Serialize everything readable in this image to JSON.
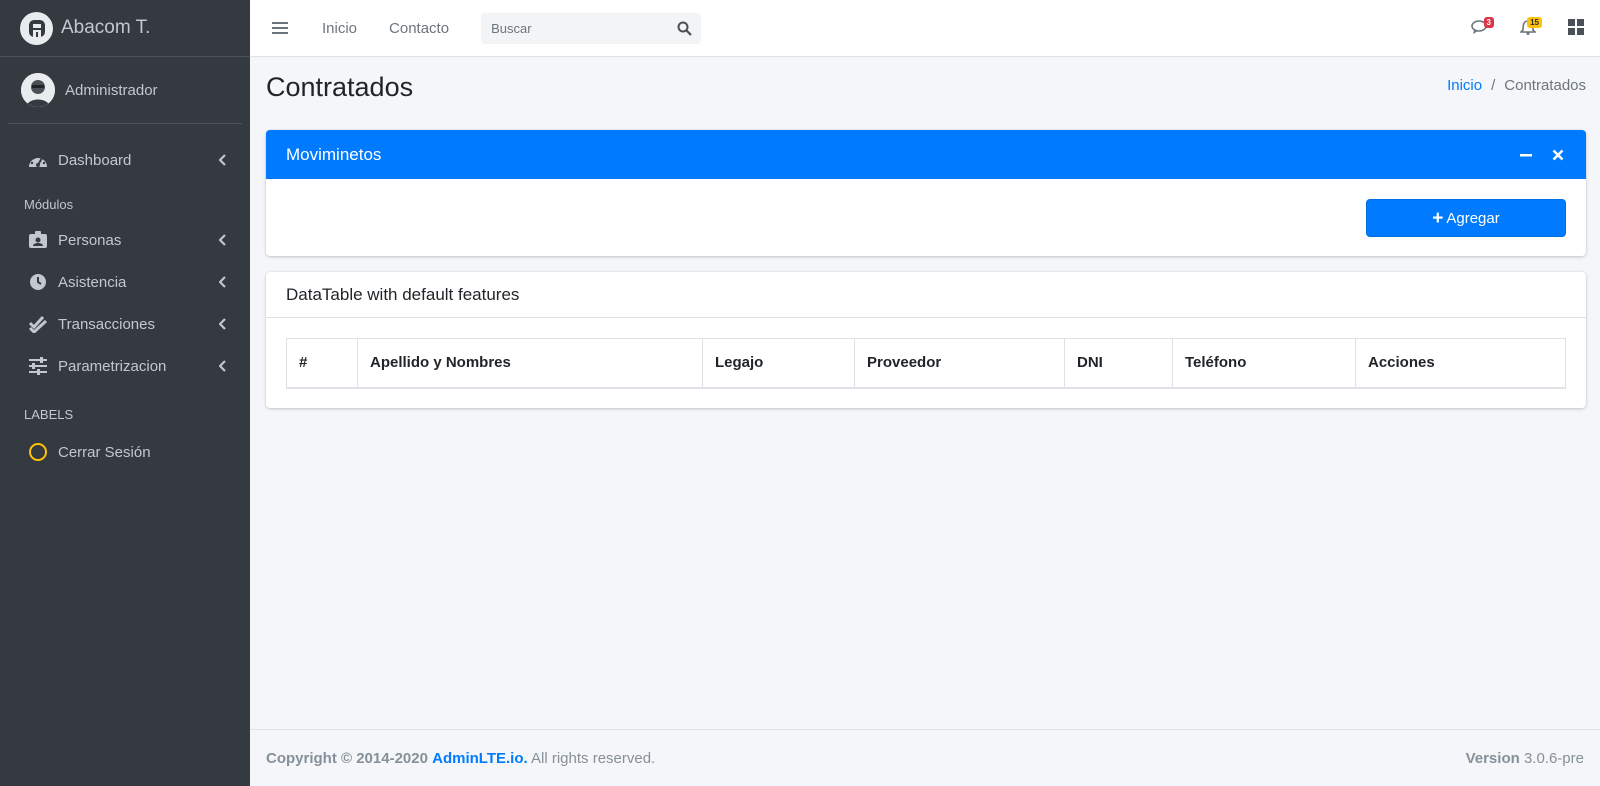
{
  "brand": {
    "name": "Abacom T."
  },
  "user": {
    "name": "Administrador"
  },
  "sidebar": {
    "dashboard": {
      "label": "Dashboard"
    },
    "modules_header": "Módulos",
    "items": [
      {
        "label": "Personas"
      },
      {
        "label": "Asistencia"
      },
      {
        "label": "Transacciones"
      },
      {
        "label": "Parametrizacion"
      }
    ],
    "labels_header": "LABELS",
    "logout": {
      "label": "Cerrar Sesión"
    }
  },
  "navbar": {
    "links": [
      "Inicio",
      "Contacto"
    ],
    "search_placeholder": "Buscar",
    "messages_count": "3",
    "notifications_count": "15"
  },
  "page": {
    "title": "Contratados",
    "breadcrumb": {
      "home": "Inicio",
      "current": "Contratados"
    }
  },
  "card_movimientos": {
    "title": "Moviminetos",
    "add_button": "Agregar"
  },
  "card_table": {
    "title": "DataTable with default features",
    "columns": [
      "#",
      "Apellido y Nombres",
      "Legajo",
      "Proveedor",
      "DNI",
      "Teléfono",
      "Acciones"
    ]
  },
  "footer": {
    "copyright": "Copyright © 2014-2020",
    "brand_link": "AdminLTE.io.",
    "rights": " All rights reserved.",
    "version_label": "Version",
    "version_value": " 3.0.6-pre"
  },
  "colors": {
    "primary": "#007bff",
    "sidebar_bg": "#343a40",
    "danger": "#dc3545",
    "warning": "#ffc107",
    "logout_ring": "#ffc107"
  }
}
